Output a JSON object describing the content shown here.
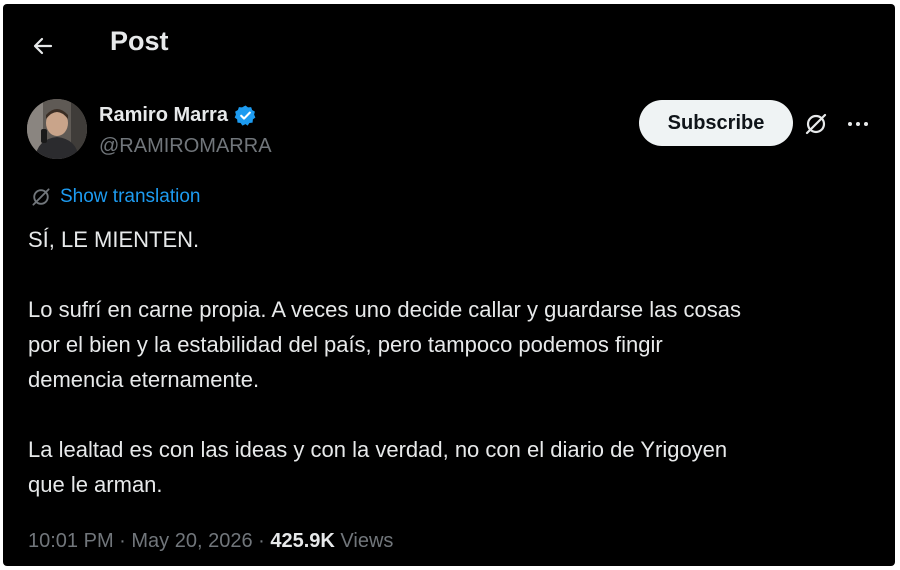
{
  "header": {
    "title": "Post"
  },
  "author": {
    "name": "Ramiro Marra",
    "handle": "@RAMIROMARRA"
  },
  "actions": {
    "subscribe_label": "Subscribe"
  },
  "post": {
    "translate_label": "Show translation",
    "text": "SÍ, LE MIENTEN.\n\nLo sufrí en carne propia. A veces uno decide callar y guardarse las cosas\npor el bien y la estabilidad del país, pero tampoco podemos fingir\ndemencia eternamente.\n\nLa lealtad es con las ideas y con la verdad, no con el diario de Yrigoyen\nque le arman."
  },
  "meta": {
    "time": "10:01 PM",
    "separator": " · ",
    "date": "May 20, 2026",
    "views_count": "425.9K",
    "views_label": " Views"
  },
  "icons": {
    "back": "back-arrow-icon",
    "verified": "verified-badge-icon",
    "grok": "grok-icon",
    "more": "more-icon",
    "translate": "translate-icon"
  },
  "colors": {
    "background": "#000000",
    "accent": "#1d9bf0",
    "text": "#e7e9ea",
    "muted": "#71767b"
  }
}
